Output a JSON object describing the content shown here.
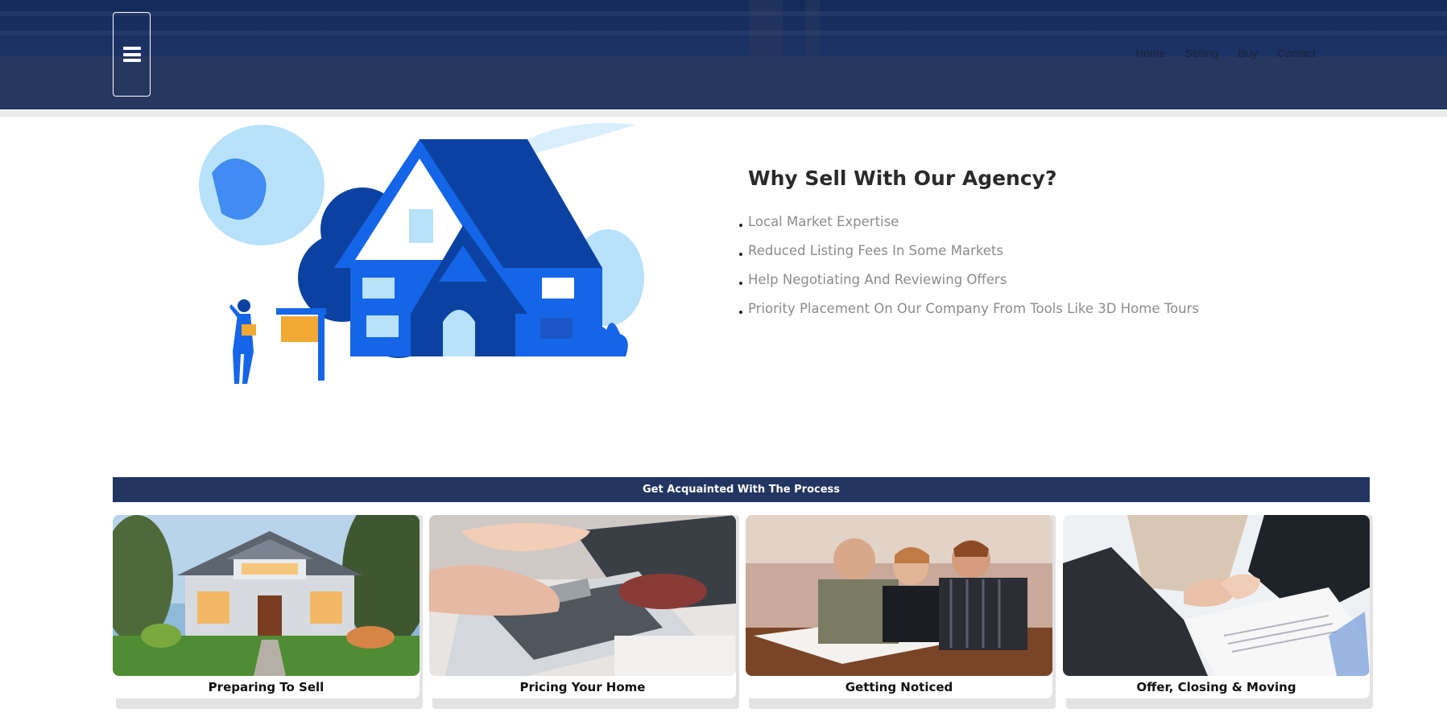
{
  "header": {
    "menu_icon": "hamburger-menu-icon",
    "nav": [
      "Home",
      "Selling",
      "Buy",
      "Contact"
    ]
  },
  "hero": {
    "title": "Why Sell With Our Agency?",
    "points": [
      "Local Market Expertise",
      "Reduced Listing Fees In Some Markets",
      "Help Negotiating And Reviewing Offers",
      "Priority Placement On Our Company From Tools Like 3D Home Tours"
    ],
    "illustration": "house-for-sale-illustration"
  },
  "process": {
    "title": "Get Acquainted With The Process",
    "cards": [
      {
        "label": "Preparing To Sell",
        "image": "house-exterior-photo"
      },
      {
        "label": "Pricing Your Home",
        "image": "calculator-photo"
      },
      {
        "label": "Getting Noticed",
        "image": "family-meeting-photo"
      },
      {
        "label": "Offer, Closing & Moving",
        "image": "handshake-contract-photo"
      }
    ]
  },
  "colors": {
    "header_bg": "#263760",
    "accent_blue": "#1565e8",
    "dark_blue": "#0b42a2",
    "light_blue": "#b8e1fb",
    "sign_orange": "#f2a934",
    "process_bar": "#233561"
  }
}
